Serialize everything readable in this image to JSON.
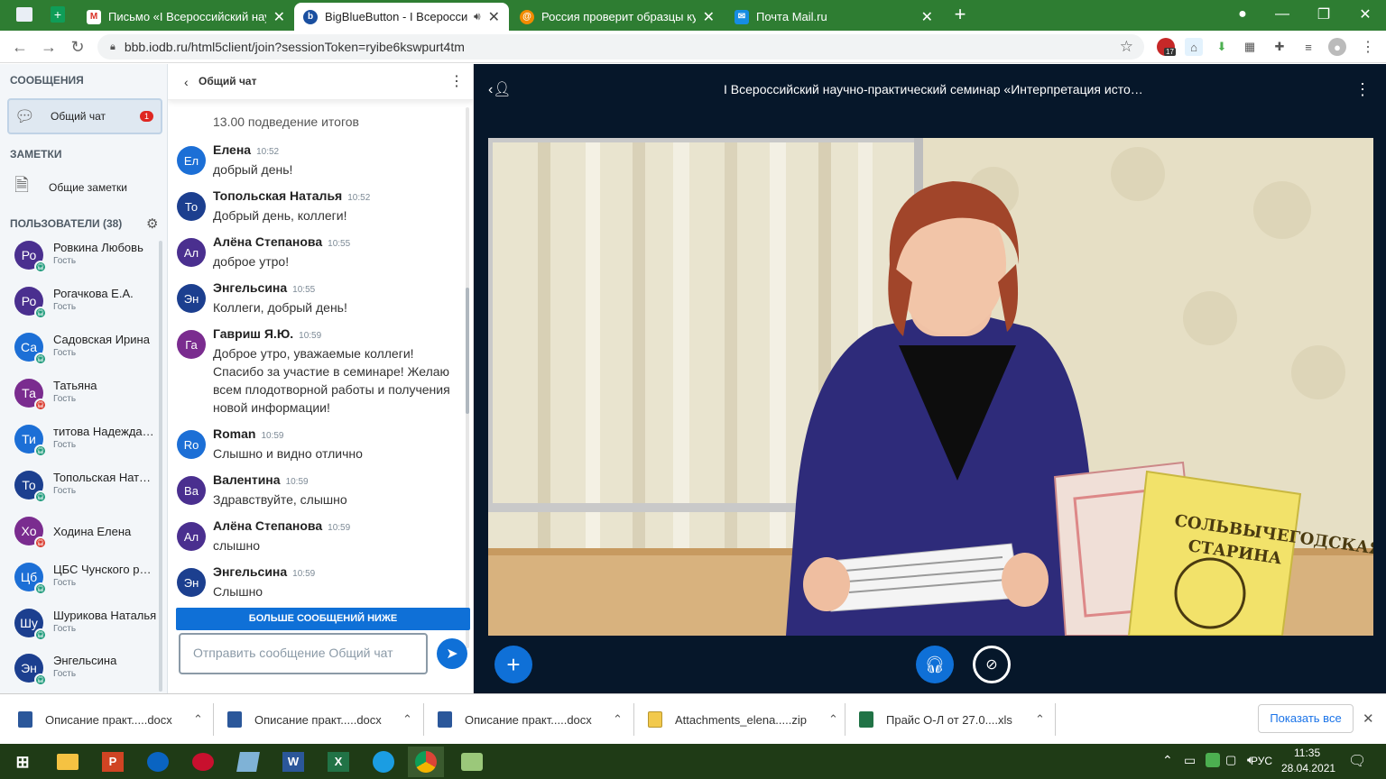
{
  "browser": {
    "tabs": [
      {
        "title": "Письмо «I Всероссийский науч",
        "favicon": "gmail-icon",
        "color": "#d93025"
      },
      {
        "title": "BigBlueButton - I Всероссий",
        "favicon": "bigbluebutton-icon",
        "color": "#1a4fa0"
      },
      {
        "title": "Россия проверит образцы купл",
        "favicon": "news-icon",
        "color": "#f28b00"
      },
      {
        "title": "Почта Mail.ru",
        "favicon": "mail-icon",
        "color": "#168de2"
      }
    ],
    "url": "bbb.iodb.ru/html5client/join?sessionToken=ryibe6kswpurt4tm",
    "ext_badge": "17"
  },
  "left_panel": {
    "messages_header": "СООБЩЕНИЯ",
    "public_chat_label": "Общий чат",
    "public_chat_badge": "1",
    "notes_header": "ЗАМЕТКИ",
    "shared_notes_label": "Общие заметки",
    "users_header": "ПОЛЬЗОВАТЕЛИ (38)",
    "users": [
      {
        "initials": "Ро",
        "name": "Ровкина Любовь",
        "role": "Гость",
        "color": "#4a2f8f",
        "badge": "#1c9a7a"
      },
      {
        "initials": "Ро",
        "name": "Рогачкова Е.А.",
        "role": "Гость",
        "color": "#4a2f8f",
        "badge": "#1c9a7a"
      },
      {
        "initials": "Са",
        "name": "Садовская Ирина",
        "role": "Гость",
        "color": "#1c6fd6",
        "badge": "#1c9a7a"
      },
      {
        "initials": "Та",
        "name": "Татьяна",
        "role": "Гость",
        "color": "#7a2c8f",
        "badge": "#d9382c"
      },
      {
        "initials": "Ти",
        "name": "титова Надежда Але",
        "role": "Гость",
        "color": "#1c6fd6",
        "badge": "#1c9a7a"
      },
      {
        "initials": "То",
        "name": "Топольская Наталья",
        "role": "Гость",
        "color": "#1c3f8f",
        "badge": "#1c9a7a"
      },
      {
        "initials": "Хо",
        "name": "Ходина Елена",
        "role": "",
        "color": "#7a2c8f",
        "badge": "#d9382c"
      },
      {
        "initials": "Цб",
        "name": "ЦБС Чунского района",
        "role": "Гость",
        "color": "#1c6fd6",
        "badge": "#1c9a7a"
      },
      {
        "initials": "Шу",
        "name": "Шурикова Наталья",
        "role": "Гость",
        "color": "#1c3f8f",
        "badge": "#1c9a7a"
      },
      {
        "initials": "Эн",
        "name": "Энгельсина",
        "role": "Гость",
        "color": "#1c3f8f",
        "badge": "#1c9a7a"
      }
    ]
  },
  "chat": {
    "title": "Общий чат",
    "top_text": "13.00 подведение итогов",
    "messages": [
      {
        "initials": "Ел",
        "name": "Елена",
        "time": "10:52",
        "text": "добрый день!",
        "color": "#1c6fd6"
      },
      {
        "initials": "То",
        "name": "Топольская Наталья",
        "time": "10:52",
        "text": "Добрый день, коллеги!",
        "color": "#1c3f8f"
      },
      {
        "initials": "Ал",
        "name": "Алёна Степанова",
        "time": "10:55",
        "text": "доброе утро!",
        "color": "#4a2f8f"
      },
      {
        "initials": "Эн",
        "name": "Энгельсина",
        "time": "10:55",
        "text": "Коллеги, добрый день!",
        "color": "#1c3f8f"
      },
      {
        "initials": "Га",
        "name": "Гавриш Я.Ю.",
        "time": "10:59",
        "text": "Доброе утро, уважаемые коллеги! Спасибо за участие в семинаре! Желаю всем плодотворной работы и получения новой информации!",
        "color": "#7a2c8f"
      },
      {
        "initials": "Ro",
        "name": "Roman",
        "time": "10:59",
        "text": "Слышно и видно отлично",
        "color": "#1c6fd6"
      },
      {
        "initials": "Ва",
        "name": "Валентина",
        "time": "10:59",
        "text": "Здравствуйте, слышно",
        "color": "#4a2f8f"
      },
      {
        "initials": "Ал",
        "name": "Алёна Степанова",
        "time": "10:59",
        "text": "слышно",
        "color": "#4a2f8f"
      },
      {
        "initials": "Эн",
        "name": "Энгельсина",
        "time": "10:59",
        "text": "Слышно",
        "color": "#1c3f8f"
      }
    ],
    "more_below": "БОЛЬШЕ СООБЩЕНИЙ НИЖЕ",
    "input_placeholder": "Отправить сообщение Общий чат"
  },
  "meeting": {
    "title": "I Всероссийский научно-практический семинар «Интерпретация исто…",
    "book_title_line1": "СОЛЬВЫЧЕГОДСКАЯ",
    "book_title_line2": "СТАРИНА"
  },
  "downloads": {
    "items": [
      {
        "name": "Описание практ.....docx",
        "type": "word"
      },
      {
        "name": "Описание практ.....docx",
        "type": "word"
      },
      {
        "name": "Описание практ.....docx",
        "type": "word"
      },
      {
        "name": "Attachments_elena.....zip",
        "type": "zip"
      },
      {
        "name": "Прайс О-Л  от 27.0....xls",
        "type": "excel"
      }
    ],
    "show_all": "Показать все"
  },
  "taskbar": {
    "lang": "РУС",
    "time": "11:35",
    "date": "28.04.2021"
  }
}
